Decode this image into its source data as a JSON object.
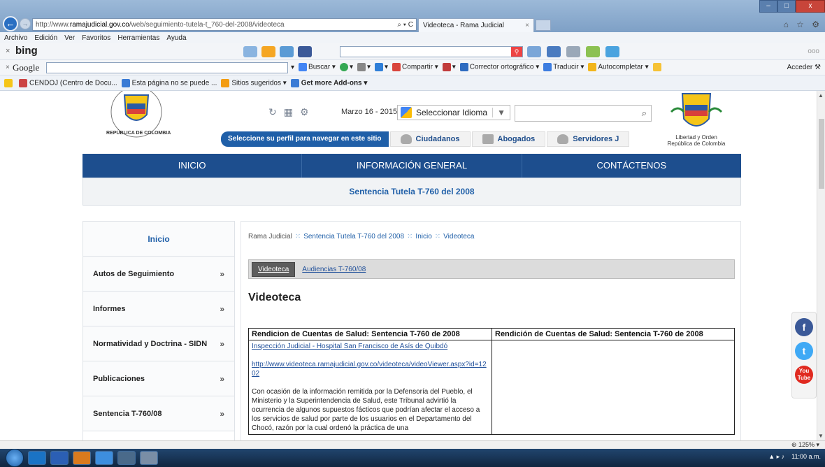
{
  "browser": {
    "url_prefix": "http://www.",
    "url_domain": "ramajudicial.gov.co",
    "url_path": "/web/seguimiento-tutela-t_760-del-2008/videoteca",
    "url_controls": "⌕ ▾ C",
    "tab_title": "Videoteca - Rama Judicial",
    "tab_close": "×",
    "back_icon": "←",
    "forward_icon": "→",
    "window_buttons": [
      "–",
      "□",
      "x"
    ],
    "right_icons": "⌂ ☆ ⚙"
  },
  "menu": [
    "Archivo",
    "Edición",
    "Ver",
    "Favoritos",
    "Herramientas",
    "Ayuda"
  ],
  "bing": {
    "close": "×",
    "logo": "bing",
    "more": "ooo"
  },
  "google": {
    "close": "×",
    "logo": "Google",
    "tools": [
      "▾",
      "Buscar ▾",
      "▾",
      "▾",
      "▾",
      "Compartir ▾",
      "▾",
      "Corrector ortográfico ▾",
      "Traducir ▾",
      "Autocompletar ▾"
    ],
    "acceder": "Acceder ⚒"
  },
  "favorites": [
    "CENDOJ (Centro de Docu...",
    "Esta página no se puede ...",
    "Sitios sugeridos ▾",
    "Get more Add-ons ▾"
  ],
  "header": {
    "date": "Marzo 16 - 2015",
    "language_select": "Seleccionar Idioma",
    "language_arrow": "▼",
    "search_icon": "⌕",
    "tool_icons": [
      "↻",
      "▦",
      "⚙"
    ],
    "profile_prompt": "Seleccione su perfil para navegar en este sitio",
    "profiles": [
      "Ciudadanos",
      "Abogados",
      "Servidores J"
    ],
    "seal_caption_1": "Libertad y Orden",
    "seal_caption_2": "República de Colombia",
    "seal_left_text": "REPÚBLICA DE COLOMBIA"
  },
  "nav": [
    "INICIO",
    "INFORMACIÓN GENERAL",
    "CONTÁCTENOS"
  ],
  "page_subtitle": "Sentencia Tutela T-760 del 2008",
  "sidebar": {
    "top": "Inicio",
    "items": [
      "Autos de Seguimiento",
      "Informes",
      "Normatividad y Doctrina - SIDN",
      "Publicaciones",
      "Sentencia T-760/08"
    ],
    "chevron": "»"
  },
  "breadcrumb": {
    "root": "Rama Judicial",
    "items": [
      "Sentencia Tutela T-760 del 2008",
      "Inicio",
      "Videoteca"
    ],
    "sep": "⁙"
  },
  "tabs": [
    "Videoteca",
    "Audiencias T-760/08"
  ],
  "content_title": "Videoteca",
  "table": {
    "headers": [
      "Rendicion de Cuentas de Salud: Sentencia T-760 de 2008",
      "Rendición de Cuentas de Salud: Sentencia T-760 de 2008"
    ],
    "link_title": "Inspección Judicial - Hospital San Francisco de Asís de Quibdó",
    "link_url": "http://www.videoteca.ramajudicial.gov.co/videoteca/videoViewer.aspx?id=1202",
    "description": "Con ocasión de la información remitida por la Defensoría del Pueblo, el Ministerio y la Superintendencia de Salud, este Tribunal advirtió la ocurrencia de algunos supuestos fácticos que podrían afectar el acceso a los servicios de salud por parte de los usuarios en el Departamento del Chocó, razón por la cual ordenó la práctica de una"
  },
  "social": [
    "f",
    "t",
    "You Tube"
  ],
  "status": {
    "zoom": "⊕ 125% ▾"
  },
  "tray": {
    "time": "11:00 a.m.",
    "icons": "▲ ▸ ♪"
  },
  "colors": {
    "nav_blue": "#1d4e8e",
    "link_blue": "#1f5fa8",
    "facebook": "#3b5998",
    "twitter": "#3fa9f5",
    "youtube": "#e02a20"
  }
}
